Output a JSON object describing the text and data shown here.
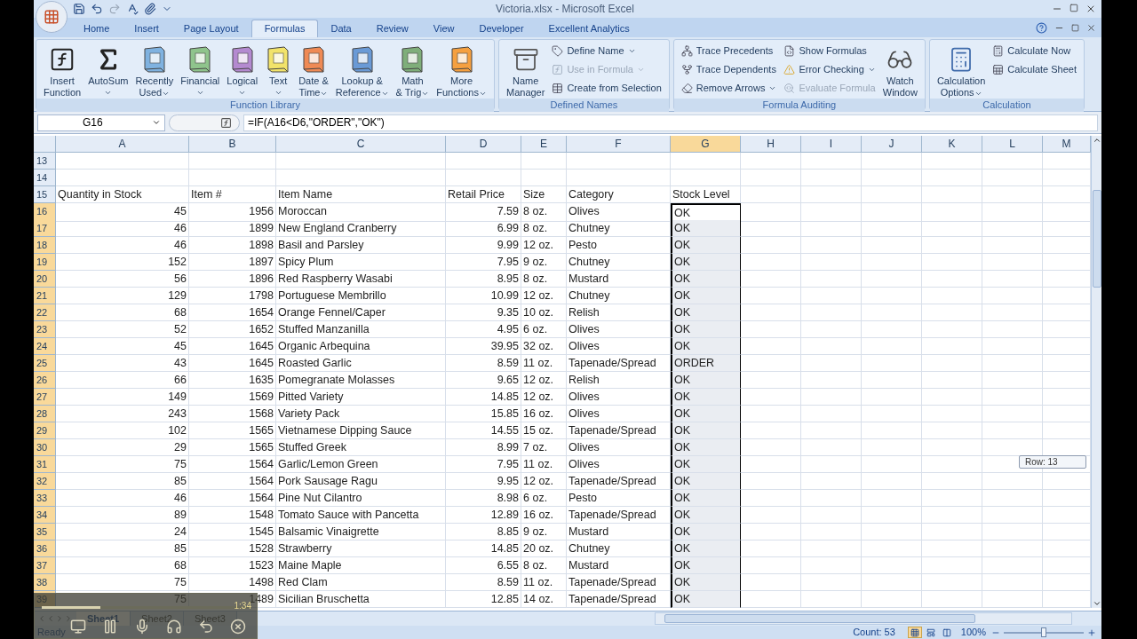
{
  "window": {
    "title": "Victoria.xlsx - Microsoft Excel"
  },
  "ribbon_tabs": [
    {
      "label": "Home",
      "selected": false
    },
    {
      "label": "Insert",
      "selected": false
    },
    {
      "label": "Page Layout",
      "selected": false
    },
    {
      "label": "Formulas",
      "selected": true
    },
    {
      "label": "Data",
      "selected": false
    },
    {
      "label": "Review",
      "selected": false
    },
    {
      "label": "View",
      "selected": false
    },
    {
      "label": "Developer",
      "selected": false
    },
    {
      "label": "Excellent Analytics",
      "selected": false
    }
  ],
  "ribbon_groups": [
    {
      "title": "Function Library",
      "items": [
        {
          "kind": "large",
          "lines": [
            "Insert",
            "Function"
          ],
          "dropdown": false,
          "disabled": false
        },
        {
          "kind": "large",
          "lines": [
            "AutoSum"
          ],
          "dropdown": true,
          "disabled": false
        },
        {
          "kind": "large",
          "lines": [
            "Recently",
            "Used"
          ],
          "dropdown": true,
          "disabled": false
        },
        {
          "kind": "large",
          "lines": [
            "Financial"
          ],
          "dropdown": true,
          "disabled": false
        },
        {
          "kind": "large",
          "lines": [
            "Logical"
          ],
          "dropdown": true,
          "disabled": false
        },
        {
          "kind": "large",
          "lines": [
            "Text"
          ],
          "dropdown": true,
          "disabled": false
        },
        {
          "kind": "large",
          "lines": [
            "Date &",
            "Time"
          ],
          "dropdown": true,
          "disabled": false
        },
        {
          "kind": "large",
          "lines": [
            "Lookup &",
            "Reference"
          ],
          "dropdown": true,
          "disabled": false
        },
        {
          "kind": "large",
          "lines": [
            "Math",
            "& Trig"
          ],
          "dropdown": true,
          "disabled": false
        },
        {
          "kind": "large",
          "lines": [
            "More",
            "Functions"
          ],
          "dropdown": true,
          "disabled": false
        }
      ]
    },
    {
      "title": "Defined Names",
      "items": [
        {
          "kind": "large",
          "lines": [
            "Name",
            "Manager"
          ],
          "dropdown": false,
          "disabled": false
        },
        {
          "kind": "small",
          "label": "Define Name",
          "dropdown": true,
          "disabled": false
        },
        {
          "kind": "small",
          "label": "Use in Formula",
          "dropdown": true,
          "disabled": true
        },
        {
          "kind": "small",
          "label": "Create from Selection",
          "dropdown": false,
          "disabled": false
        }
      ]
    },
    {
      "title": "Formula Auditing",
      "items": [
        {
          "kind": "small",
          "label": "Trace Precedents",
          "dropdown": false,
          "disabled": false
        },
        {
          "kind": "small",
          "label": "Trace Dependents",
          "dropdown": false,
          "disabled": false
        },
        {
          "kind": "small",
          "label": "Remove Arrows",
          "dropdown": true,
          "disabled": false
        },
        {
          "kind": "small",
          "label": "Show Formulas",
          "dropdown": false,
          "disabled": false
        },
        {
          "kind": "small",
          "label": "Error Checking",
          "dropdown": true,
          "disabled": false
        },
        {
          "kind": "small",
          "label": "Evaluate Formula",
          "dropdown": false,
          "disabled": true
        },
        {
          "kind": "large",
          "lines": [
            "Watch",
            "Window"
          ],
          "dropdown": false,
          "disabled": false
        }
      ]
    },
    {
      "title": "Calculation",
      "items": [
        {
          "kind": "large",
          "lines": [
            "Calculation",
            "Options"
          ],
          "dropdown": true,
          "disabled": false
        },
        {
          "kind": "small",
          "label": "Calculate Now",
          "dropdown": false,
          "disabled": false
        },
        {
          "kind": "small",
          "label": "Calculate Sheet",
          "dropdown": false,
          "disabled": false
        }
      ]
    }
  ],
  "formula_bar": {
    "name_box": "G16",
    "formula": "=IF(A16<D6,\"ORDER\",\"OK\")"
  },
  "columns": [
    {
      "label": "A",
      "selected": false
    },
    {
      "label": "B",
      "selected": false
    },
    {
      "label": "C",
      "selected": false
    },
    {
      "label": "D",
      "selected": false
    },
    {
      "label": "E",
      "selected": false
    },
    {
      "label": "F",
      "selected": false
    },
    {
      "label": "G",
      "selected": true
    },
    {
      "label": "H",
      "selected": false
    },
    {
      "label": "I",
      "selected": false
    },
    {
      "label": "J",
      "selected": false
    },
    {
      "label": "K",
      "selected": false
    },
    {
      "label": "L",
      "selected": false
    },
    {
      "label": "M",
      "selected": false
    }
  ],
  "rows": [
    {
      "number": "13",
      "selected": false,
      "kind": "blank"
    },
    {
      "number": "14",
      "selected": false,
      "kind": "blank"
    },
    {
      "number": "15",
      "selected": false,
      "kind": "header",
      "cells": [
        "Quantity in Stock",
        "Item #",
        "Item Name",
        "Retail Price",
        "Size",
        "Category",
        "Stock Level"
      ]
    },
    {
      "number": "16",
      "selected": true,
      "kind": "item",
      "cells": [
        "45",
        "1956",
        "Moroccan",
        "7.59",
        "8 oz.",
        "Olives",
        "OK"
      ]
    },
    {
      "number": "17",
      "selected": true,
      "kind": "item",
      "cells": [
        "46",
        "1899",
        "New England Cranberry",
        "6.99",
        "8 oz.",
        "Chutney",
        "OK"
      ]
    },
    {
      "number": "18",
      "selected": true,
      "kind": "item",
      "cells": [
        "46",
        "1898",
        "Basil and Parsley",
        "9.99",
        "12 oz.",
        "Pesto",
        "OK"
      ]
    },
    {
      "number": "19",
      "selected": true,
      "kind": "item",
      "cells": [
        "152",
        "1897",
        "Spicy Plum",
        "7.95",
        "9 oz.",
        "Chutney",
        "OK"
      ]
    },
    {
      "number": "20",
      "selected": true,
      "kind": "item",
      "cells": [
        "56",
        "1896",
        "Red Raspberry Wasabi",
        "8.95",
        "8 oz.",
        "Mustard",
        "OK"
      ]
    },
    {
      "number": "21",
      "selected": true,
      "kind": "item",
      "cells": [
        "129",
        "1798",
        "Portuguese Membrillo",
        "10.99",
        "12 oz.",
        "Chutney",
        "OK"
      ]
    },
    {
      "number": "22",
      "selected": true,
      "kind": "item",
      "cells": [
        "68",
        "1654",
        "Orange Fennel/Caper",
        "9.35",
        "10 oz.",
        "Relish",
        "OK"
      ]
    },
    {
      "number": "23",
      "selected": true,
      "kind": "item",
      "cells": [
        "52",
        "1652",
        "Stuffed Manzanilla",
        "4.95",
        "6 oz.",
        "Olives",
        "OK"
      ]
    },
    {
      "number": "24",
      "selected": true,
      "kind": "item",
      "cells": [
        "45",
        "1645",
        "Organic Arbequina",
        "39.95",
        "32 oz.",
        "Olives",
        "OK"
      ]
    },
    {
      "number": "25",
      "selected": true,
      "kind": "item",
      "cells": [
        "43",
        "1645",
        "Roasted Garlic",
        "8.59",
        "11 oz.",
        "Tapenade/Spread",
        "ORDER"
      ]
    },
    {
      "number": "26",
      "selected": true,
      "kind": "item",
      "cells": [
        "66",
        "1635",
        "Pomegranate Molasses",
        "9.65",
        "12 oz.",
        "Relish",
        "OK"
      ]
    },
    {
      "number": "27",
      "selected": true,
      "kind": "item",
      "cells": [
        "149",
        "1569",
        "Pitted Variety",
        "14.85",
        "12 oz.",
        "Olives",
        "OK"
      ]
    },
    {
      "number": "28",
      "selected": true,
      "kind": "item",
      "cells": [
        "243",
        "1568",
        "Variety Pack",
        "15.85",
        "16 oz.",
        "Olives",
        "OK"
      ]
    },
    {
      "number": "29",
      "selected": true,
      "kind": "item",
      "cells": [
        "102",
        "1565",
        "Vietnamese Dipping Sauce",
        "14.55",
        "15 oz.",
        "Tapenade/Spread",
        "OK"
      ]
    },
    {
      "number": "30",
      "selected": true,
      "kind": "item",
      "cells": [
        "29",
        "1565",
        "Stuffed Greek",
        "8.99",
        "7 oz.",
        "Olives",
        "OK"
      ]
    },
    {
      "number": "31",
      "selected": true,
      "kind": "item",
      "cells": [
        "75",
        "1564",
        "Garlic/Lemon Green",
        "7.95",
        "11 oz.",
        "Olives",
        "OK"
      ]
    },
    {
      "number": "32",
      "selected": true,
      "kind": "item",
      "cells": [
        "85",
        "1564",
        "Pork Sausage Ragu",
        "9.95",
        "12 oz.",
        "Tapenade/Spread",
        "OK"
      ]
    },
    {
      "number": "33",
      "selected": true,
      "kind": "item",
      "cells": [
        "46",
        "1564",
        "Pine Nut Cilantro",
        "8.98",
        "6 oz.",
        "Pesto",
        "OK"
      ]
    },
    {
      "number": "34",
      "selected": true,
      "kind": "item",
      "cells": [
        "89",
        "1548",
        "Tomato Sauce with Pancetta",
        "12.89",
        "16 oz.",
        "Tapenade/Spread",
        "OK"
      ]
    },
    {
      "number": "35",
      "selected": true,
      "kind": "item",
      "cells": [
        "24",
        "1545",
        "Balsamic Vinaigrette",
        "8.85",
        "9 oz.",
        "Mustard",
        "OK"
      ]
    },
    {
      "number": "36",
      "selected": true,
      "kind": "item",
      "cells": [
        "85",
        "1528",
        "Strawberry",
        "14.85",
        "20 oz.",
        "Chutney",
        "OK"
      ]
    },
    {
      "number": "37",
      "selected": true,
      "kind": "item",
      "cells": [
        "68",
        "1523",
        "Maine Maple",
        "6.55",
        "8 oz.",
        "Mustard",
        "OK"
      ]
    },
    {
      "number": "38",
      "selected": true,
      "kind": "item",
      "cells": [
        "75",
        "1498",
        "Red Clam",
        "8.59",
        "11 oz.",
        "Tapenade/Spread",
        "OK"
      ]
    },
    {
      "number": "39",
      "selected": true,
      "kind": "item",
      "cells": [
        "75",
        "1489",
        "Sicilian Bruschetta",
        "12.85",
        "14 oz.",
        "Tapenade/Spread",
        "OK"
      ]
    }
  ],
  "tooltip": "Row: 13",
  "sheets": [
    {
      "label": "Sheet1",
      "selected": true
    },
    {
      "label": "Sheet2",
      "selected": false
    },
    {
      "label": "Sheet3",
      "selected": false
    }
  ],
  "status_bar": {
    "mode": "Ready",
    "summary": "Count: 53",
    "view_buttons": [
      {
        "selected": true
      },
      {
        "selected": false
      },
      {
        "selected": false
      }
    ],
    "zoom": "100%",
    "zoom_slider": {
      "level": 0.5
    }
  },
  "player": {
    "time": "1:34",
    "level": 0.28
  }
}
